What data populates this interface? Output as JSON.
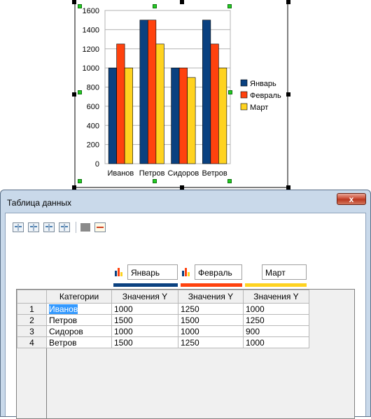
{
  "chart_data": {
    "type": "bar",
    "categories": [
      "Иванов",
      "Петров",
      "Сидоров",
      "Ветров"
    ],
    "series": [
      {
        "name": "Январь",
        "values": [
          1000,
          1500,
          1000,
          1500
        ],
        "color": "#0a4180"
      },
      {
        "name": "Февраль",
        "values": [
          1250,
          1500,
          1000,
          1250
        ],
        "color": "#ff420e"
      },
      {
        "name": "Март",
        "values": [
          1000,
          1250,
          900,
          1000
        ],
        "color": "#ffd320"
      }
    ],
    "ylim": [
      0,
      1600
    ],
    "yticks": [
      0,
      200,
      400,
      600,
      800,
      1000,
      1200,
      1400,
      1600
    ],
    "grid": true,
    "legend": "right"
  },
  "dialog": {
    "title": "Таблица данных",
    "close_label": "x",
    "toolbar_icons": [
      "insert-row-icon",
      "insert-column-icon",
      "delete-row-icon",
      "delete-column-icon",
      "text-format-icon",
      "swap-data-icon"
    ]
  },
  "table": {
    "headers": [
      "Категории",
      "Значения Y",
      "Значения Y",
      "Значения Y"
    ],
    "rows": [
      {
        "num": "1",
        "cells": [
          "Иванов",
          "1000",
          "1250",
          "1000"
        ]
      },
      {
        "num": "2",
        "cells": [
          "Петров",
          "1500",
          "1500",
          "1250"
        ]
      },
      {
        "num": "3",
        "cells": [
          "Сидоров",
          "1000",
          "1000",
          "900"
        ]
      },
      {
        "num": "4",
        "cells": [
          "Ветров",
          "1500",
          "1250",
          "1000"
        ]
      }
    ]
  }
}
